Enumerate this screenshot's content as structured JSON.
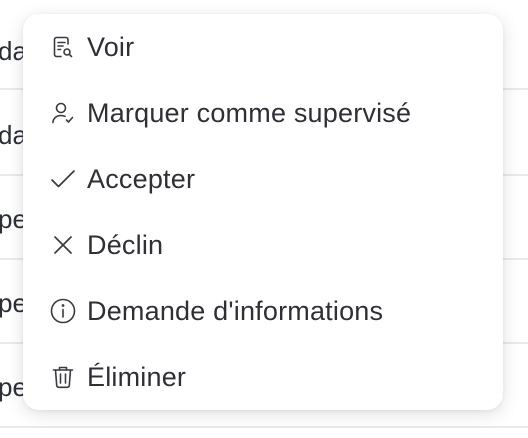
{
  "background": {
    "rows": [
      {
        "text": "da"
      },
      {
        "text": "da"
      },
      {
        "text": "pe"
      },
      {
        "text": "pe"
      },
      {
        "text": "pe"
      }
    ]
  },
  "menu": {
    "items": [
      {
        "label": "Voir",
        "icon": "view-document-icon"
      },
      {
        "label": "Marquer comme supervisé",
        "icon": "user-check-icon"
      },
      {
        "label": "Accepter",
        "icon": "check-icon"
      },
      {
        "label": "Déclin",
        "icon": "close-icon"
      },
      {
        "label": "Demande d'informations",
        "icon": "info-icon"
      },
      {
        "label": "Éliminer",
        "icon": "trash-icon"
      }
    ]
  },
  "colors": {
    "text": "#2f3035",
    "icon": "#3a3b40",
    "background": "#ffffff",
    "divider": "#e9eaed"
  }
}
